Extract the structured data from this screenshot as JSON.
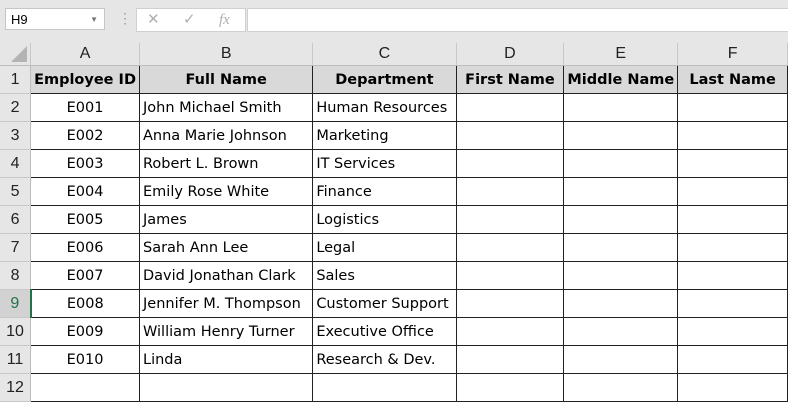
{
  "formula_bar": {
    "name_box": "H9",
    "cancel_icon": "✕",
    "enter_icon": "✓",
    "fx_label": "fx",
    "formula": ""
  },
  "columns": [
    "A",
    "B",
    "C",
    "D",
    "E",
    "F"
  ],
  "header": [
    "Employee ID",
    "Full Name",
    "Department",
    "First Name",
    "Middle Name",
    "Last Name"
  ],
  "rows": [
    [
      "E001",
      "John Michael Smith",
      "Human Resources",
      "",
      "",
      ""
    ],
    [
      "E002",
      "Anna Marie Johnson",
      "Marketing",
      "",
      "",
      ""
    ],
    [
      "E003",
      "Robert L. Brown",
      "IT Services",
      "",
      "",
      ""
    ],
    [
      "E004",
      "Emily Rose White",
      "Finance",
      "",
      "",
      ""
    ],
    [
      "E005",
      "James",
      "Logistics",
      "",
      "",
      ""
    ],
    [
      "E006",
      "Sarah Ann Lee",
      "Legal",
      "",
      "",
      ""
    ],
    [
      "E007",
      "David Jonathan Clark",
      "Sales",
      "",
      "",
      ""
    ],
    [
      "E008",
      "Jennifer M. Thompson",
      "Customer Support",
      "",
      "",
      ""
    ],
    [
      "E009",
      "William Henry Turner",
      "Executive Office",
      "",
      "",
      ""
    ],
    [
      "E010",
      "Linda",
      "Research & Dev.",
      "",
      "",
      ""
    ],
    [
      "",
      "",
      "",
      "",
      "",
      ""
    ]
  ],
  "row_numbers": [
    "1",
    "2",
    "3",
    "4",
    "5",
    "6",
    "7",
    "8",
    "9",
    "10",
    "11",
    "12"
  ],
  "selected_row": "9"
}
